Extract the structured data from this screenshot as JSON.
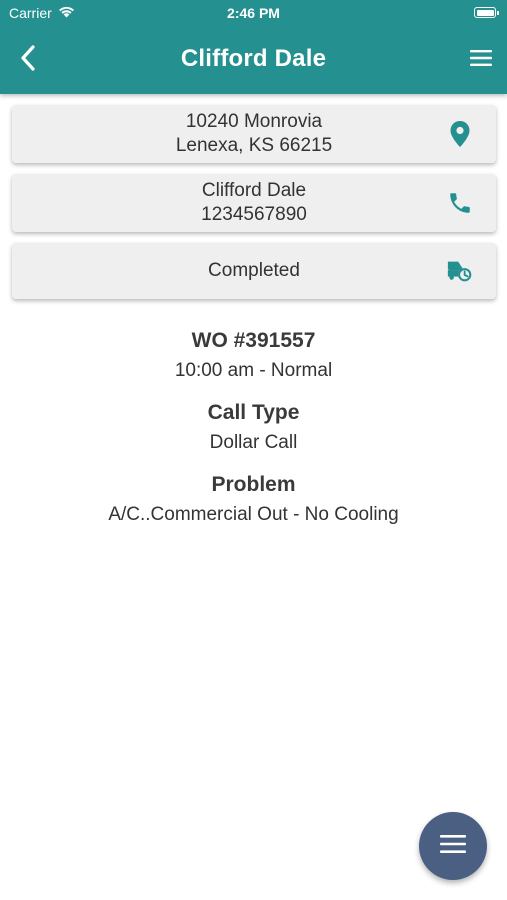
{
  "status_bar": {
    "carrier": "Carrier",
    "time": "2:46 PM",
    "wifi_icon": "wifi-icon",
    "battery_icon": "battery-icon"
  },
  "header": {
    "title": "Clifford Dale",
    "back_icon": "chevron-left-icon",
    "menu_icon": "hamburger-menu-icon",
    "background_color": "#24908f"
  },
  "cards": {
    "address": {
      "line1": "10240 Monrovia",
      "line2": "Lenexa, KS  66215",
      "icon": "location-pin-icon"
    },
    "contact": {
      "name": "Clifford Dale",
      "phone": "1234567890",
      "icon": "phone-icon"
    },
    "status": {
      "label": "Completed",
      "icon": "truck-clock-icon"
    }
  },
  "work_order": {
    "number": "WO #391557",
    "schedule": "10:00 am - Normal",
    "call_type_label": "Call Type",
    "call_type_value": "Dollar Call",
    "problem_label": "Problem",
    "problem_value": "A/C..Commercial Out - No Cooling"
  },
  "fab": {
    "icon": "hamburger-menu-icon",
    "color": "#4a5f82"
  },
  "colors": {
    "accent": "#24908f",
    "card_background": "#efefef",
    "text": "#333333"
  }
}
